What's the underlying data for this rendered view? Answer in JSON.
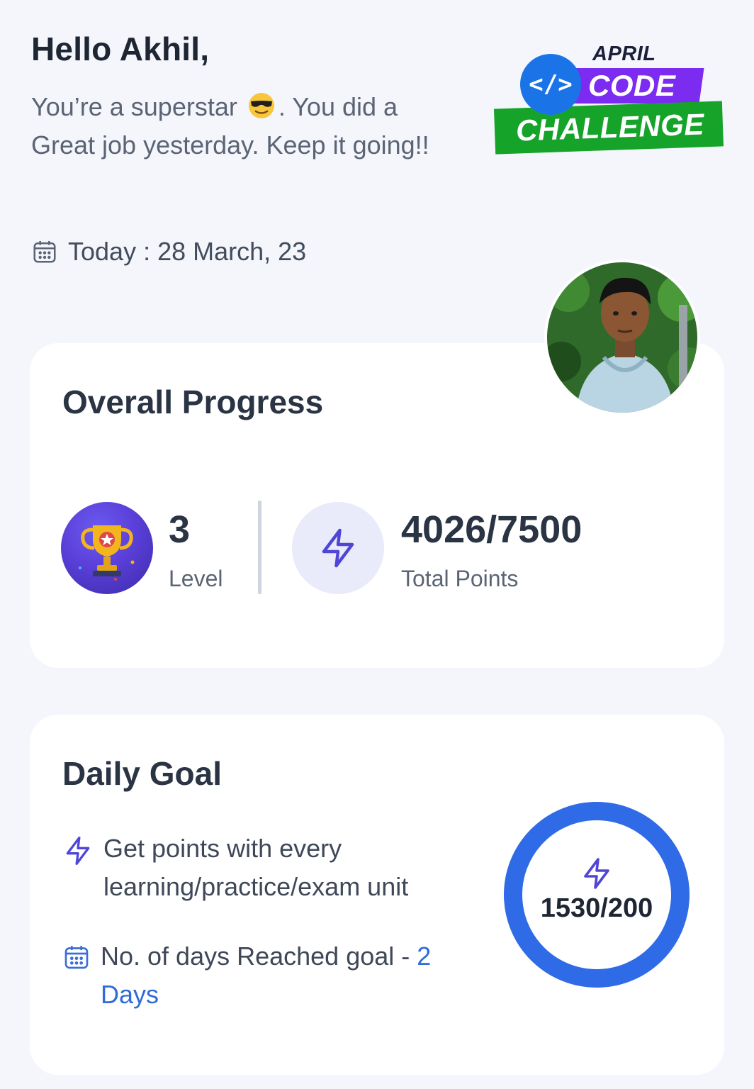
{
  "header": {
    "greeting": "Hello Akhil,",
    "message_part1": "You’re a superstar",
    "message_emoji": "sunglasses-emoji",
    "message_part2": ". You did a Great job yesterday. Keep it going!!",
    "today_label": "Today : 28 March, 23"
  },
  "badge": {
    "top": "APRIL",
    "code": "CODE",
    "challenge": "CHALLENGE",
    "symbol": "</>"
  },
  "overall_progress": {
    "title": "Overall Progress",
    "level_value": "3",
    "level_label": "Level",
    "points_value": "4026/7500",
    "points_label": "Total Points"
  },
  "daily_goal": {
    "title": "Daily Goal",
    "item1": "Get points with every learning/practice/exam unit",
    "item2_prefix": "No. of days Reached goal - ",
    "item2_value": "2 Days",
    "ring_value": "1530/200"
  },
  "colors": {
    "accent": "#5b4be0",
    "ring": "#2f6be6",
    "days": "#2f6bd9",
    "background": "#f4f6fc"
  },
  "icons": [
    "calendar-icon",
    "trophy-icon",
    "lightning-icon",
    "avatar-photo"
  ]
}
